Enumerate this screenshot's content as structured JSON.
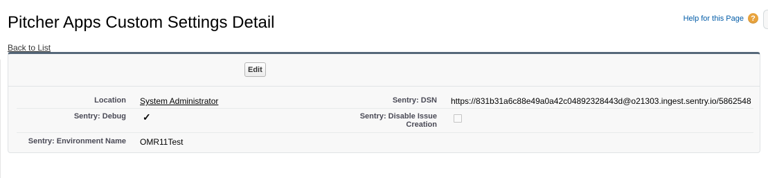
{
  "header": {
    "title": "Pitcher Apps Custom Settings Detail",
    "help_label": "Help for this Page",
    "help_icon": "?"
  },
  "nav": {
    "back_label": "Back to List"
  },
  "toolbar": {
    "edit_label": "Edit"
  },
  "details": {
    "location_label": "Location",
    "location_value": "System Administrator",
    "dsn_label": "Sentry: DSN",
    "dsn_value": "https://831b31a6c88e49a0a42c04892328443d@o21303.ingest.sentry.io/5862548",
    "debug_label": "Sentry: Debug",
    "debug_checked": true,
    "debug_mark": "✓",
    "disable_label_line1": "Sentry: Disable Issue",
    "disable_label_line2": "Creation",
    "disable_checked": false,
    "env_label": "Sentry: Environment Name",
    "env_value": "OMR11Test"
  },
  "colors": {
    "panel_top_border": "#56687a",
    "link_blue": "#015ba7",
    "help_icon_bg": "#e8a33d",
    "label_gray": "#4a4a56"
  }
}
